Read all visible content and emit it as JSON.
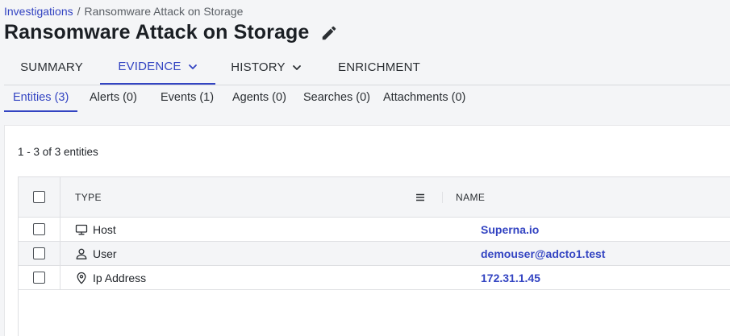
{
  "breadcrumb": {
    "root": "Investigations",
    "separator": "/",
    "current": "Ransomware Attack on Storage"
  },
  "page": {
    "title": "Ransomware Attack on Storage",
    "edit_icon": "pencil-icon"
  },
  "tabs": [
    {
      "label": "SUMMARY",
      "active": false,
      "dropdown": false
    },
    {
      "label": "EVIDENCE",
      "active": true,
      "dropdown": true
    },
    {
      "label": "HISTORY",
      "active": false,
      "dropdown": true
    },
    {
      "label": "ENRICHMENT",
      "active": false,
      "dropdown": false
    }
  ],
  "subtabs": [
    {
      "label": "Entities (3)",
      "active": true
    },
    {
      "label": "Alerts (0)",
      "active": false
    },
    {
      "label": "Events (1)",
      "active": false
    },
    {
      "label": "Agents (0)",
      "active": false
    },
    {
      "label": "Searches (0)",
      "active": false
    },
    {
      "label": "Attachments (0)",
      "active": false
    }
  ],
  "entities": {
    "count_text": "1 - 3 of 3 entities",
    "columns": {
      "type": "TYPE",
      "name": "NAME"
    },
    "rows": [
      {
        "type": "Host",
        "icon": "monitor-icon",
        "name": "Superna.io"
      },
      {
        "type": "User",
        "icon": "user-icon",
        "name": "demouser@adcto1.test"
      },
      {
        "type": "Ip Address",
        "icon": "location-pin-icon",
        "name": "172.31.1.45"
      }
    ]
  },
  "colors": {
    "accent": "#3344c2",
    "background": "#f4f5f7",
    "text": "#1f2328"
  }
}
